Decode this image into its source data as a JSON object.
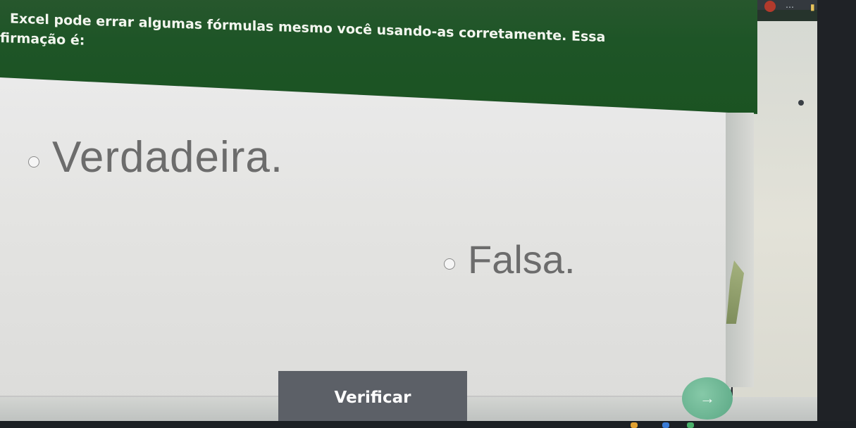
{
  "question": {
    "line1": "Excel pode errar algumas fórmulas mesmo você usando-as corretamente. Essa",
    "line2": "firmação é:"
  },
  "options": [
    {
      "label": "Verdadeira."
    },
    {
      "label": "Falsa."
    }
  ],
  "verify_button": {
    "label": "Verificar"
  },
  "next_button": {
    "icon": "arrow-right-icon"
  },
  "colors": {
    "header_green": "#1e5527",
    "button_grey": "#5c6067",
    "option_text": "#6c6c6c",
    "next_button": "#5aa784"
  }
}
